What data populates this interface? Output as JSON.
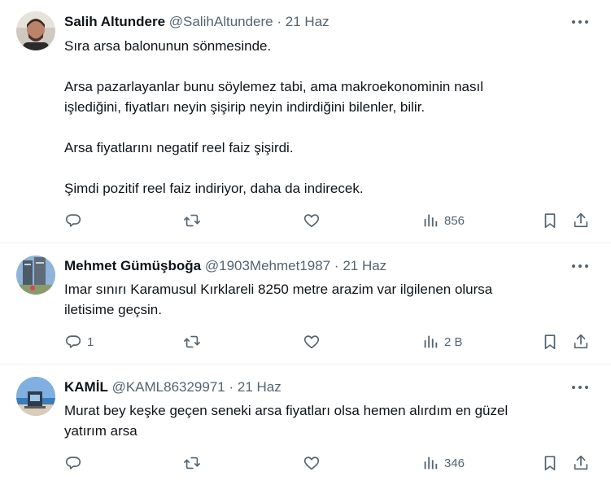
{
  "tweets": [
    {
      "name": "Salih Altundere",
      "handle": "@SalihAltundere",
      "dot": "·",
      "date": "21 Haz",
      "paragraphs": [
        "Sıra arsa balonunun sönmesinde.",
        "Arsa pazarlayanlar bunu söylemez tabi, ama makroekonominin nasıl",
        "işlediğini, fiyatları neyin şişirip neyin indirdiğini bilenler, bilir.",
        "Arsa fiyatlarını negatif reel faiz şişirdi.",
        "Şimdi pozitif reel faiz indiriyor, daha da indirecek."
      ],
      "reply_count": "",
      "retweet_count": "",
      "like_count": "",
      "views": "856"
    },
    {
      "name": "Mehmet Gümüşboğa",
      "handle": "@1903Mehmet1987",
      "dot": "·",
      "date": "21 Haz",
      "paragraphs": [
        "Imar sınırı Karamusul Kırklareli 8250 metre arazim var ilgilenen olursa",
        "iletisime geçsin."
      ],
      "reply_count": "1",
      "retweet_count": "",
      "like_count": "",
      "views": "2 B"
    },
    {
      "name": "KAMİL",
      "handle": "@KAML86329971",
      "dot": "·",
      "date": "21 Haz",
      "paragraphs": [
        "Murat bey keşke geçen seneki arsa fiyatları olsa hemen alırdım en güzel",
        "yatırım arsa"
      ],
      "reply_count": "",
      "retweet_count": "",
      "like_count": "",
      "views": "346"
    }
  ],
  "icons": {
    "reply": "reply-icon",
    "retweet": "retweet-icon",
    "like": "heart-icon",
    "views": "views-icon",
    "bookmark": "bookmark-icon",
    "share": "share-icon",
    "more": "more-icon"
  },
  "colors": {
    "text": "#0f1419",
    "secondary": "#536471",
    "divider": "#eff3f4"
  }
}
